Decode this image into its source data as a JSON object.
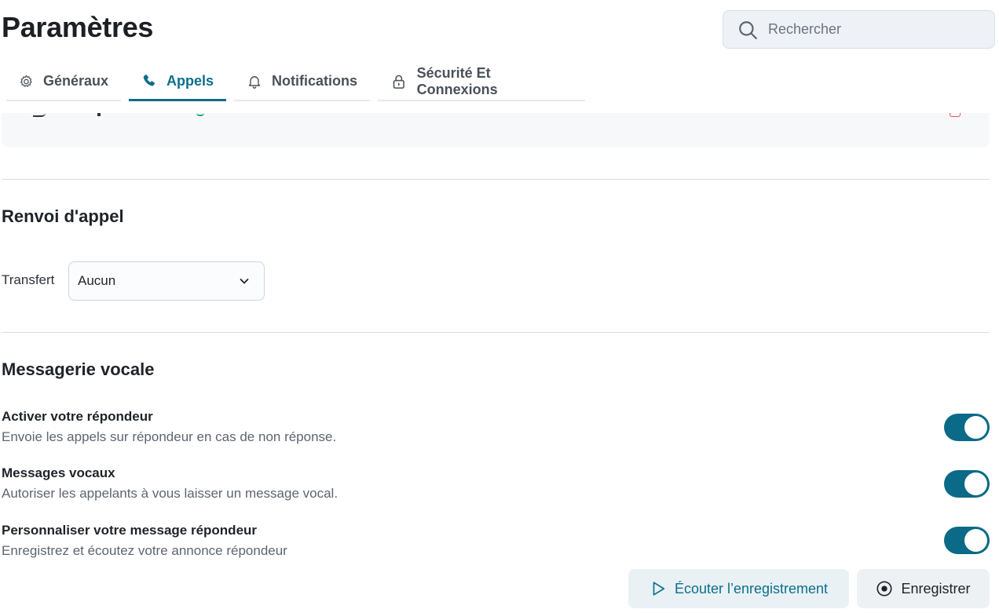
{
  "header": {
    "title": "Paramètres",
    "search_placeholder": "Rechercher"
  },
  "tabs": [
    {
      "label": "Généraux",
      "icon": "gear-icon",
      "active": false
    },
    {
      "label": "Appels",
      "icon": "phone-icon",
      "active": true
    },
    {
      "label": "Notifications",
      "icon": "bell-icon",
      "active": false
    },
    {
      "label": "Sécurité Et Connexions",
      "icon": "lock-icon",
      "active": false
    }
  ],
  "call_forwarding": {
    "title": "Renvoi d'appel",
    "transfer_label": "Transfert",
    "transfer_value": "Aucun"
  },
  "voicemail": {
    "title": "Messagerie vocale",
    "settings": [
      {
        "title": "Activer votre répondeur",
        "description": "Envoie les appels sur répondeur en cas de non réponse.",
        "enabled": true
      },
      {
        "title": "Messages vocaux",
        "description": "Autoriser les appelants à vous laisser un message vocal.",
        "enabled": true
      },
      {
        "title": "Personnaliser votre message répondeur",
        "description": "Enregistrez et écoutez votre annonce répondeur",
        "enabled": true
      }
    ],
    "listen_button": "Écouter l’enregistrement",
    "record_button": "Enregistrer"
  },
  "colors": {
    "accent": "#0d6e8c",
    "toggle_on": "#0a6a87",
    "danger": "#e05555"
  }
}
